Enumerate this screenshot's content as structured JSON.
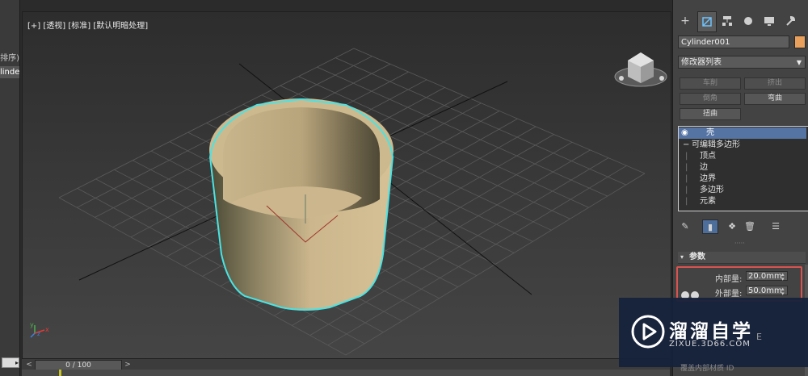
{
  "left_strip": {
    "items": [
      {
        "label": "排序)"
      },
      {
        "label": "linder"
      }
    ],
    "bottom_button": "▸"
  },
  "viewport": {
    "label": "[+] [透视] [标准] [默认明暗处理]",
    "axis_labels": {
      "y": "y",
      "x": "x",
      "z": "z"
    }
  },
  "timeline": {
    "slider": "0 / 100",
    "prev": "<",
    "next": ">"
  },
  "command_panel": {
    "object_name": "Cylinder001",
    "object_color": "#e8a05c",
    "modifier_list": "修改器列表",
    "modifier_buttons": [
      {
        "label": "车削",
        "enabled": false
      },
      {
        "label": "挤出",
        "enabled": false
      },
      {
        "label": "倒角",
        "enabled": false
      },
      {
        "label": "弯曲",
        "enabled": true
      },
      {
        "label": "扭曲",
        "enabled": true
      }
    ],
    "stack": [
      {
        "label": "壳",
        "selected": true,
        "indent": 0,
        "icon": "eye-icon"
      },
      {
        "label": "可编辑多边形",
        "selected": false,
        "indent": 0,
        "icon": "minus-expander-icon"
      },
      {
        "label": "顶点",
        "selected": false,
        "indent": 1
      },
      {
        "label": "边",
        "selected": false,
        "indent": 1
      },
      {
        "label": "边界",
        "selected": false,
        "indent": 1
      },
      {
        "label": "多边形",
        "selected": false,
        "indent": 1
      },
      {
        "label": "元素",
        "selected": false,
        "indent": 1
      }
    ],
    "parameters": {
      "rollout_title": "参数",
      "inner_label": "内部量:",
      "inner_value": "20.0mm",
      "outer_label": "外部量:",
      "outer_value": "50.0mm",
      "partial_last_row": "覆盖内部材质 ID"
    }
  },
  "watermark": {
    "title": "溜溜自学",
    "url": "ZIXUE.3D66.COM",
    "partial": "E"
  },
  "colors": {
    "selection_outline": "#48e4e4",
    "highlight_box": "#d9534f",
    "stack_selected": "#5574a3"
  }
}
